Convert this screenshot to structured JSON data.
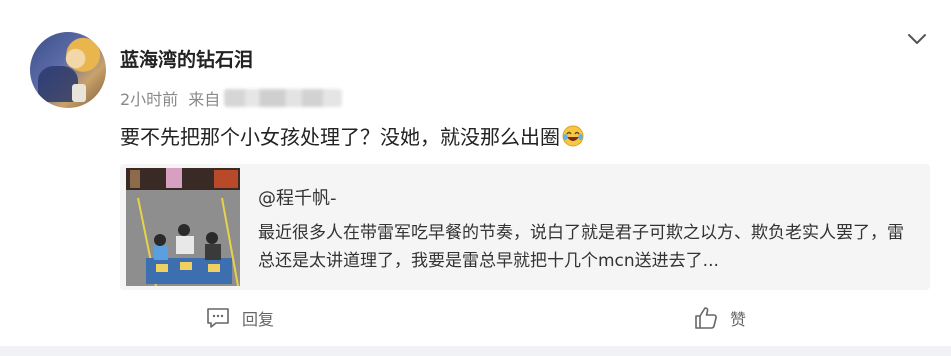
{
  "comment": {
    "username": "蓝海湾的钻石泪",
    "time": "2小时前",
    "source_prefix": "来自",
    "text": "要不先把那个小女孩处理了？没她，就没那么出圈"
  },
  "quote": {
    "user": "@程千帆-",
    "text": "最近很多人在带雷军吃早餐的节奏，说白了就是君子可欺之以方、欺负老实人罢了，雷总还是太讲道理了，我要是雷总早就把十几个mcn送进去了..."
  },
  "actions": {
    "reply_label": "回复",
    "like_label": "赞"
  },
  "icons": {
    "more": "chevron-down-icon",
    "emoji": "laugh-cry-emoji-icon",
    "reply": "comment-icon",
    "like": "thumbs-up-icon"
  },
  "colors": {
    "text": "#222222",
    "meta": "#8a8a8a",
    "quote_bg": "#f5f5f5"
  }
}
